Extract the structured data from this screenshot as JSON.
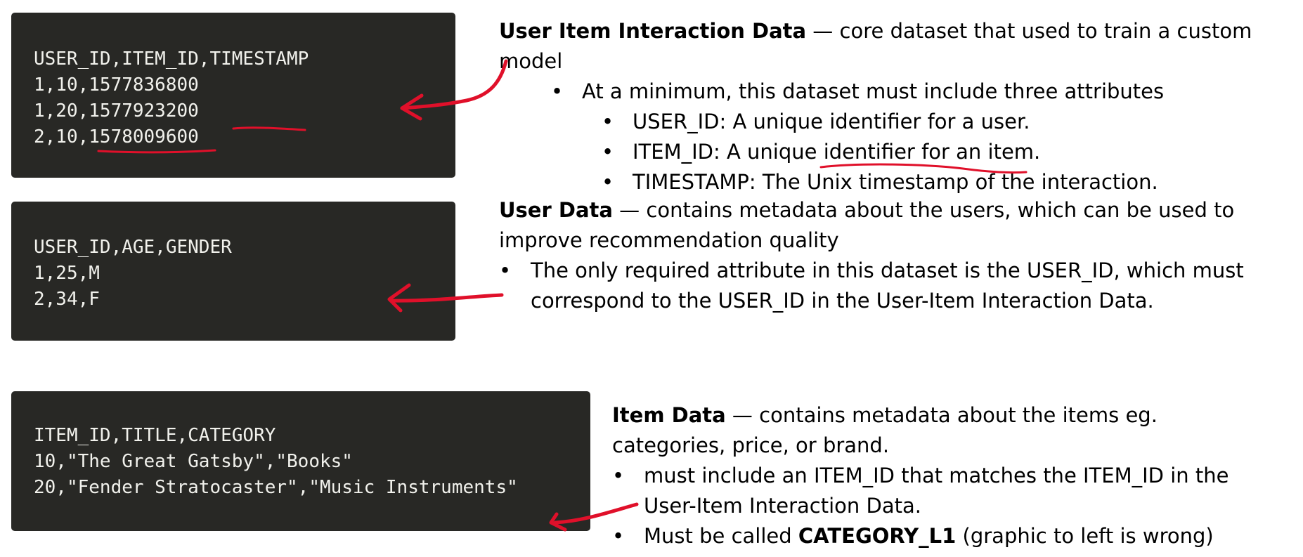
{
  "sections": [
    {
      "code_lines": [
        "USER_ID,ITEM_ID,TIMESTAMP",
        "1,10,1577836800",
        "1,20,1577923200",
        "2,10,1578009600"
      ],
      "heading": "User Item Interaction Data",
      "heading_rest": " — core dataset that used to train a custom model",
      "bullets": [
        {
          "text": "At a minimum, this dataset must include three attributes",
          "sub_bullets": [
            "USER_ID: A unique identifier for a user.",
            "ITEM_ID: A unique identifier for an item.",
            "TIMESTAMP: The Unix timestamp of the interaction."
          ]
        }
      ]
    },
    {
      "code_lines": [
        "USER_ID,AGE,GENDER",
        "1,25,M",
        "2,34,F"
      ],
      "heading": "User Data",
      "heading_rest": " — contains metadata about the users, which can be used to improve recommendation quality",
      "bullets": [
        "The only required attribute in this dataset is the USER_ID, which must correspond to the USER_ID in the User-Item Interaction Data."
      ]
    },
    {
      "code_lines": [
        "ITEM_ID,TITLE,CATEGORY",
        "10,\"The Great Gatsby\",\"Books\"",
        "20,\"Fender Stratocaster\",\"Music Instruments\""
      ],
      "heading": "Item Data",
      "heading_rest": " — contains metadata about the items eg. categories, price, or brand.",
      "bullets": [
        "must include an ITEM_ID that matches the ITEM_ID in the User-Item Interaction Data.",
        {
          "pre": "Must be called ",
          "bold": "CATEGORY_L1",
          "post": " (graphic to left is wrong)"
        }
      ]
    }
  ],
  "bullet_char": "•",
  "annotation_color": "#e0102a"
}
